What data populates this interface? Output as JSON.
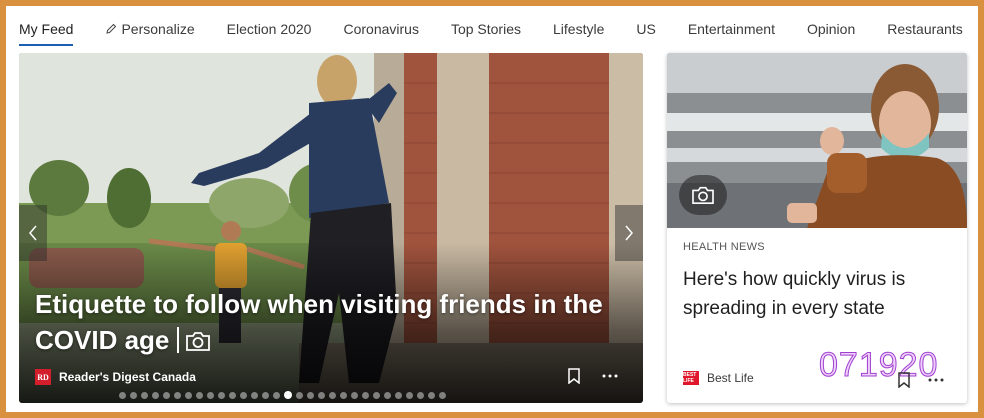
{
  "nav": {
    "items": [
      {
        "label": "My Feed",
        "active": true
      },
      {
        "label": "Personalize",
        "icon": "pencil-icon"
      },
      {
        "label": "Election 2020"
      },
      {
        "label": "Coronavirus"
      },
      {
        "label": "Top Stories"
      },
      {
        "label": "Lifestyle"
      },
      {
        "label": "US"
      },
      {
        "label": "Entertainment"
      },
      {
        "label": "Opinion"
      },
      {
        "label": "Restaurants"
      }
    ]
  },
  "hero": {
    "title_line1": "Etiquette to follow when visiting friends in the",
    "title_line2": "COVID age",
    "title_icon": "camera-icon",
    "source_logo": "RD",
    "source_name": "Reader's Digest Canada",
    "dots_total": 30,
    "dots_active": 15
  },
  "card": {
    "category": "HEALTH NEWS",
    "title": "Here's how quickly virus is spreading in every state",
    "source_name": "Best Life",
    "source_logo": "BEST LIFE",
    "watermark": "071920"
  },
  "colors": {
    "frame": "#d9913f",
    "nav_active_underline": "#1a5fb4",
    "rd_red": "#d21f2b",
    "watermark": "#c776e8"
  }
}
